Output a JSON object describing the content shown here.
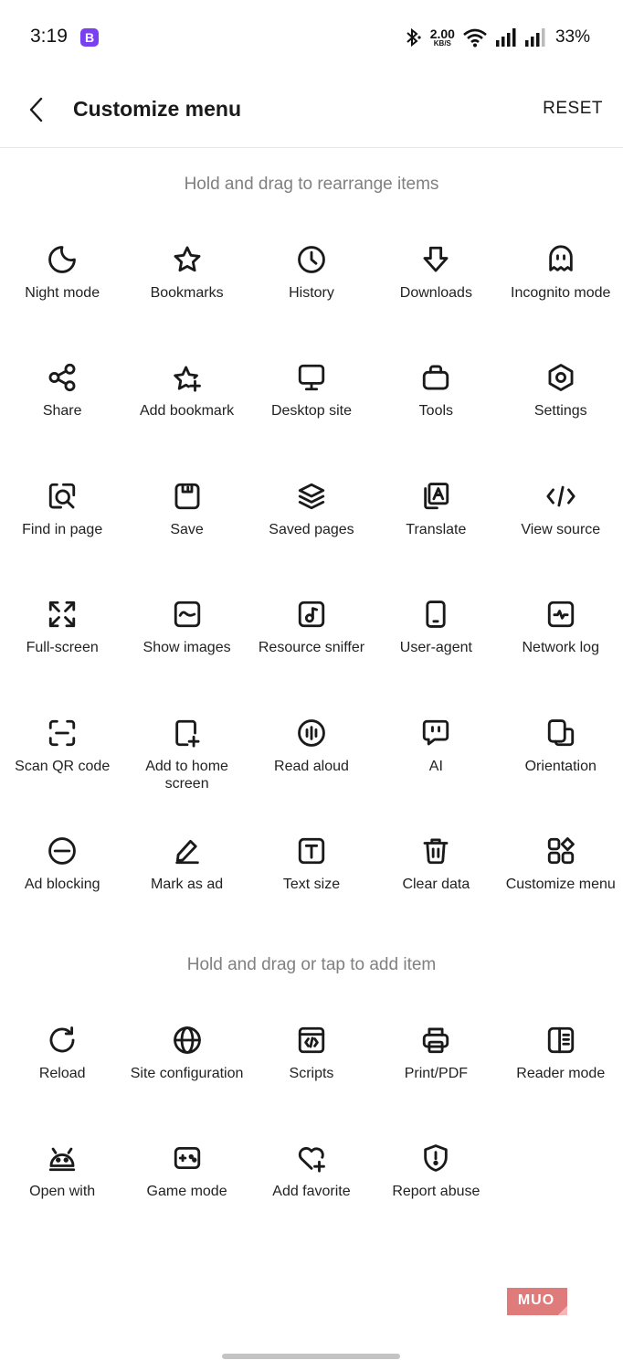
{
  "status_bar": {
    "time": "3:19",
    "app_badge": "B",
    "net_speed": "2.00",
    "net_unit": "KB/S",
    "battery": "33%"
  },
  "header": {
    "title": "Customize menu",
    "reset_label": "RESET"
  },
  "active_section": {
    "hint": "Hold and drag to rearrange items",
    "items": [
      {
        "label": "Night mode",
        "icon": "moon-icon"
      },
      {
        "label": "Bookmarks",
        "icon": "star-icon"
      },
      {
        "label": "History",
        "icon": "clock-icon"
      },
      {
        "label": "Downloads",
        "icon": "download-arrow-icon"
      },
      {
        "label": "Incognito mode",
        "icon": "ghost-icon"
      },
      {
        "label": "Share",
        "icon": "share-icon"
      },
      {
        "label": "Add bookmark",
        "icon": "star-plus-icon"
      },
      {
        "label": "Desktop site",
        "icon": "monitor-icon"
      },
      {
        "label": "Tools",
        "icon": "toolbox-icon"
      },
      {
        "label": "Settings",
        "icon": "hexagon-gear-icon"
      },
      {
        "label": "Find in page",
        "icon": "find-in-page-icon"
      },
      {
        "label": "Save",
        "icon": "floppy-icon"
      },
      {
        "label": "Saved pages",
        "icon": "layers-icon"
      },
      {
        "label": "Translate",
        "icon": "translate-icon"
      },
      {
        "label": "View source",
        "icon": "code-icon"
      },
      {
        "label": "Full-screen",
        "icon": "fullscreen-icon"
      },
      {
        "label": "Show images",
        "icon": "image-icon"
      },
      {
        "label": "Resource sniffer",
        "icon": "music-note-icon"
      },
      {
        "label": "User-agent",
        "icon": "phone-icon"
      },
      {
        "label": "Network log",
        "icon": "pulse-icon"
      },
      {
        "label": "Scan QR code",
        "icon": "scan-icon"
      },
      {
        "label": "Add to home screen",
        "icon": "add-to-home-icon"
      },
      {
        "label": "Read aloud",
        "icon": "audio-bars-icon"
      },
      {
        "label": "AI",
        "icon": "chat-bubble-icon"
      },
      {
        "label": "Orientation",
        "icon": "rotate-screen-icon"
      },
      {
        "label": "Ad blocking",
        "icon": "block-icon"
      },
      {
        "label": "Mark as ad",
        "icon": "pencil-icon"
      },
      {
        "label": "Text size",
        "icon": "text-box-icon"
      },
      {
        "label": "Clear data",
        "icon": "trash-icon"
      },
      {
        "label": "Customize menu",
        "icon": "grid-shapes-icon"
      }
    ]
  },
  "available_section": {
    "hint": "Hold and drag or tap to add item",
    "items": [
      {
        "label": "Reload",
        "icon": "reload-icon"
      },
      {
        "label": "Site configuration",
        "icon": "globe-icon"
      },
      {
        "label": "Scripts",
        "icon": "script-icon"
      },
      {
        "label": "Print/PDF",
        "icon": "printer-icon"
      },
      {
        "label": "Reader mode",
        "icon": "reader-icon"
      },
      {
        "label": "Open with",
        "icon": "android-icon"
      },
      {
        "label": "Game mode",
        "icon": "gamepad-icon"
      },
      {
        "label": "Add favorite",
        "icon": "heart-plus-icon"
      },
      {
        "label": "Report abuse",
        "icon": "shield-alert-icon"
      }
    ]
  },
  "watermark": "MUO"
}
